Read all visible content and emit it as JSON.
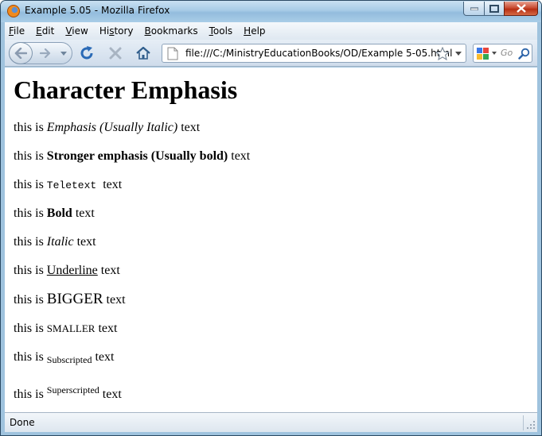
{
  "window": {
    "title": "Example 5.05 - Mozilla Firefox",
    "icon": "firefox-icon"
  },
  "menu": [
    {
      "pre": "",
      "accel": "F",
      "post": "ile"
    },
    {
      "pre": "",
      "accel": "E",
      "post": "dit"
    },
    {
      "pre": "",
      "accel": "V",
      "post": "iew"
    },
    {
      "pre": "Hi",
      "accel": "s",
      "post": "tory"
    },
    {
      "pre": "",
      "accel": "B",
      "post": "ookmarks"
    },
    {
      "pre": "",
      "accel": "T",
      "post": "ools"
    },
    {
      "pre": "",
      "accel": "H",
      "post": "elp"
    }
  ],
  "navbar": {
    "url": "file:///C:/MinistryEducationBooks/OD/Example 5-05.html",
    "search_placeholder": "Go",
    "icons": [
      "back-icon",
      "forward-icon",
      "reload-icon",
      "stop-icon",
      "home-icon",
      "page-icon",
      "star-icon",
      "google-icon",
      "magnifier-icon"
    ]
  },
  "content": {
    "heading": "Character Emphasis",
    "prefix": "this is",
    "suffix": "text",
    "emphasis": "Emphasis (Usually Italic)",
    "strong": "Stronger emphasis (Usually bold)",
    "teletext": "Teletext",
    "bold": "Bold",
    "italic": "Italic",
    "underline": "Underline",
    "bigger": "BIGGER",
    "smaller": "SMALLER",
    "subscripted": "Subscripted",
    "superscripted": "Superscripted"
  },
  "status": {
    "text": "Done"
  },
  "colors": {
    "frame": "#9fc3de",
    "close_button": "#c6442a",
    "reload_icon": "#2a6ab6"
  }
}
